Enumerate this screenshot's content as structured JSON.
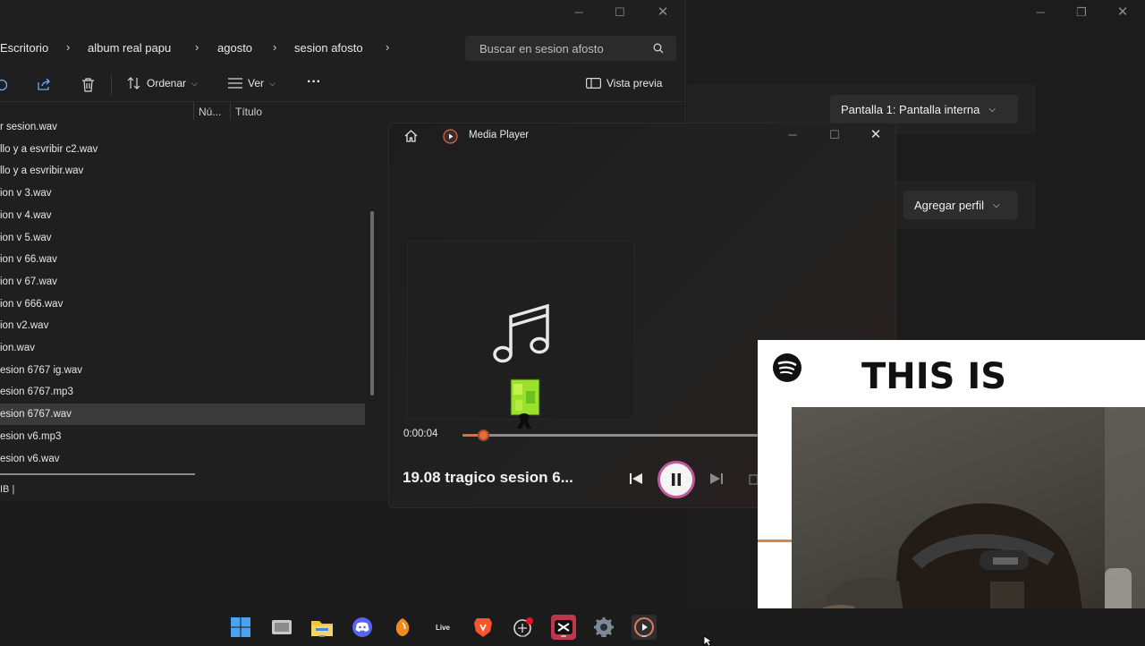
{
  "settings": {
    "display_dropdown": "Pantalla 1: Pantalla interna",
    "profile_dropdown": "Agregar perfil",
    "window_controls": [
      "minimize",
      "restore",
      "close"
    ]
  },
  "explorer": {
    "breadcrumb": [
      "Escritorio",
      "album real papu",
      "agosto",
      "sesion afosto"
    ],
    "search_placeholder": "Buscar en sesion afosto",
    "toolbar": {
      "sort_label": "Ordenar",
      "view_label": "Ver",
      "more_label": "···",
      "preview_label": "Vista previa"
    },
    "columns": [
      "Nú...",
      "Título"
    ],
    "files": [
      "r sesion.wav",
      "llo  y a esvribir c2.wav",
      "llo  y a esvribir.wav",
      "ion v 3.wav",
      "ion v 4.wav",
      "ion v 5.wav",
      "ion v 66.wav",
      "ion v 67.wav",
      "ion v 666.wav",
      "ion v2.wav",
      "ion.wav",
      "esion 6767 ig.wav",
      "esion 6767.mp3",
      "esion 6767.wav",
      "esion v6.mp3",
      "esion v6.wav"
    ],
    "selected_index": 13,
    "status_text": "IB  |"
  },
  "media_player": {
    "app_title": "Media Player",
    "current_time": "0:00:04",
    "progress": 0.07,
    "track_title": "19.08 tragico sesion 6...",
    "state": "playing"
  },
  "overlay": {
    "headline": "THIS IS",
    "brand_icon": "spotify-icon"
  },
  "taskbar": {
    "apps": [
      "windows-start",
      "task-view",
      "file-explorer",
      "discord",
      "fl-studio",
      "live",
      "brave",
      "chat",
      "capcut",
      "settings",
      "media-player"
    ],
    "live_label": "Live"
  },
  "colors": {
    "accent": "#e46b3e",
    "background": "#1a1a1a",
    "overlay_bg": "#ffffff"
  }
}
